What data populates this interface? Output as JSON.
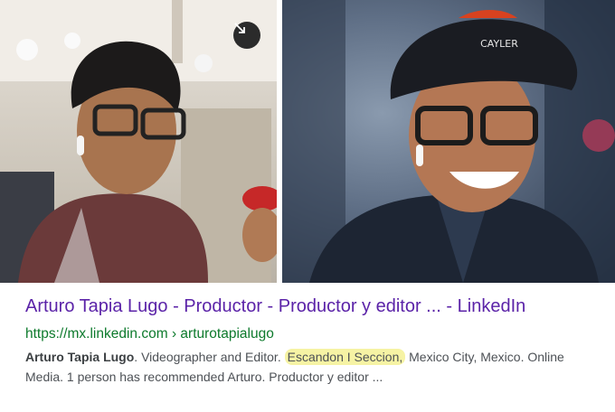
{
  "photos": {
    "left_alt": "Arturo Tapia Lugo",
    "right_alt": "Arturo Tapia Lugo",
    "right_cap_text": "CAYLER",
    "expand_icon": "expand-arrow-icon"
  },
  "result": {
    "title": "Arturo Tapia Lugo - Productor - Productor y editor ... - LinkedIn",
    "url": "https://mx.linkedin.com › arturotapialugo",
    "snippet_name": "Arturo Tapia Lugo",
    "snippet_part1": ". Videographer and Editor. ",
    "snippet_highlight": "Escandon I Seccion,",
    "snippet_part2": " Mexico City, Mexico. Online Media. 1 person has recommended Arturo. Productor y editor ...",
    "highlight_color": "#f6f3a4"
  }
}
